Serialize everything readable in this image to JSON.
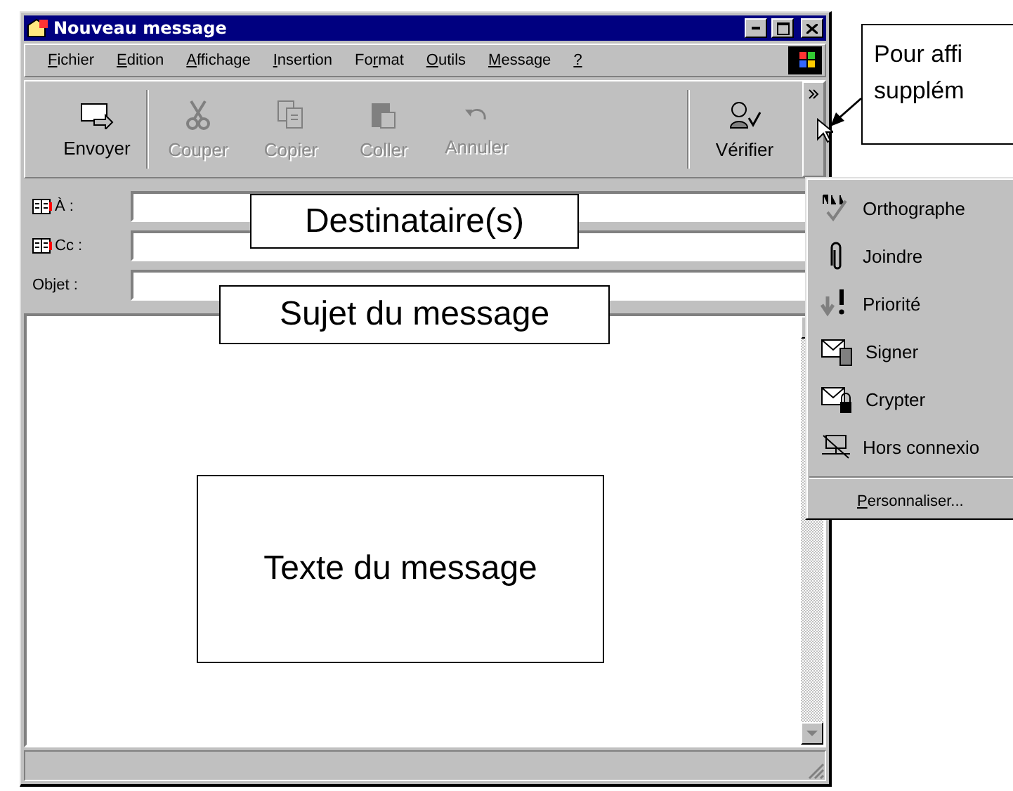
{
  "window": {
    "title": "Nouveau message"
  },
  "menu": [
    {
      "label": "Fichier"
    },
    {
      "label": "Edition"
    },
    {
      "label": "Affichage"
    },
    {
      "label": "Insertion"
    },
    {
      "label": "Format"
    },
    {
      "label": "Outils"
    },
    {
      "label": "Message"
    },
    {
      "label": "?"
    }
  ],
  "toolbar": [
    {
      "label": "Envoyer",
      "kind": "send",
      "disabled": false
    },
    {
      "label": "Couper",
      "kind": "cut",
      "disabled": true
    },
    {
      "label": "Copier",
      "kind": "copy",
      "disabled": true
    },
    {
      "label": "Coller",
      "kind": "paste",
      "disabled": true
    },
    {
      "label": "Annuler",
      "kind": "undo",
      "disabled": true
    },
    {
      "label": "Vérifier",
      "kind": "check",
      "disabled": false
    }
  ],
  "header_fields": [
    {
      "label": "À :",
      "address_book": true
    },
    {
      "label": "Cc :",
      "address_book": true
    },
    {
      "label": "Objet :",
      "address_book": false
    }
  ],
  "more_menu": {
    "items": [
      {
        "label": "Orthographe",
        "kind": "spell"
      },
      {
        "label": "Joindre",
        "kind": "clip"
      },
      {
        "label": "Priorité",
        "kind": "priority"
      },
      {
        "label": "Signer",
        "kind": "sign"
      },
      {
        "label": "Crypter",
        "kind": "encrypt"
      },
      {
        "label": "Hors connexio",
        "kind": "offline"
      }
    ],
    "footer": {
      "label": "Personnaliser..."
    }
  },
  "annotations": [
    "Destinataire(s)",
    "Sujet du message",
    "Texte du message"
  ],
  "callout": {
    "lines": [
      "Pour affi",
      "supplém"
    ]
  }
}
